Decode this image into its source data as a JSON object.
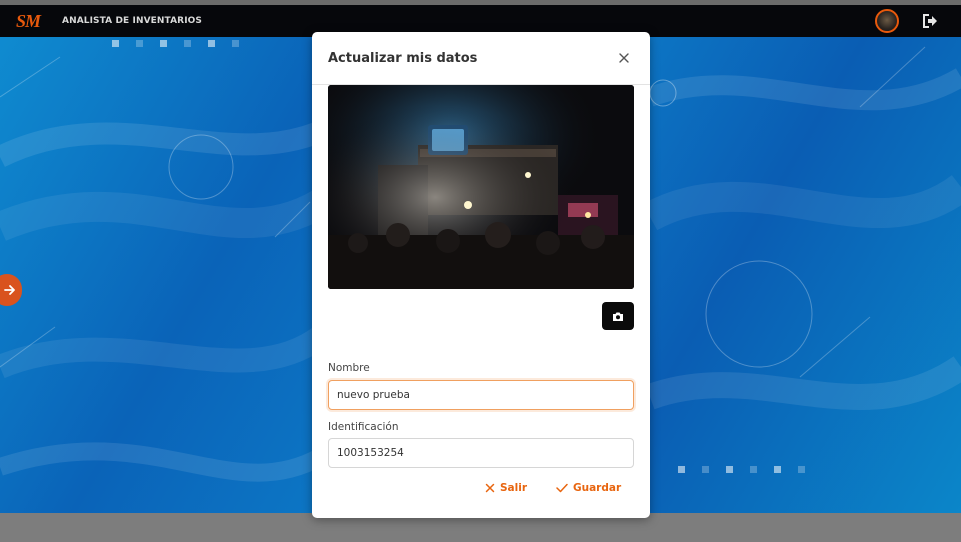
{
  "navbar": {
    "logo_text": "SM",
    "role_label": "ANALISTA DE INVENTARIOS",
    "avatar_icon": "profile-avatar",
    "logout_icon": "logout-icon",
    "accent_color": "#e8590c"
  },
  "modal": {
    "title": "Actualizar mis datos",
    "photo_alt": "Foto de perfil",
    "fields": {
      "name_label": "Nombre",
      "name_value": "nuevo prueba",
      "id_label": "Identificación",
      "id_value": "1003153254"
    },
    "buttons": {
      "exit_label": "Salir",
      "save_label": "Guardar"
    }
  }
}
